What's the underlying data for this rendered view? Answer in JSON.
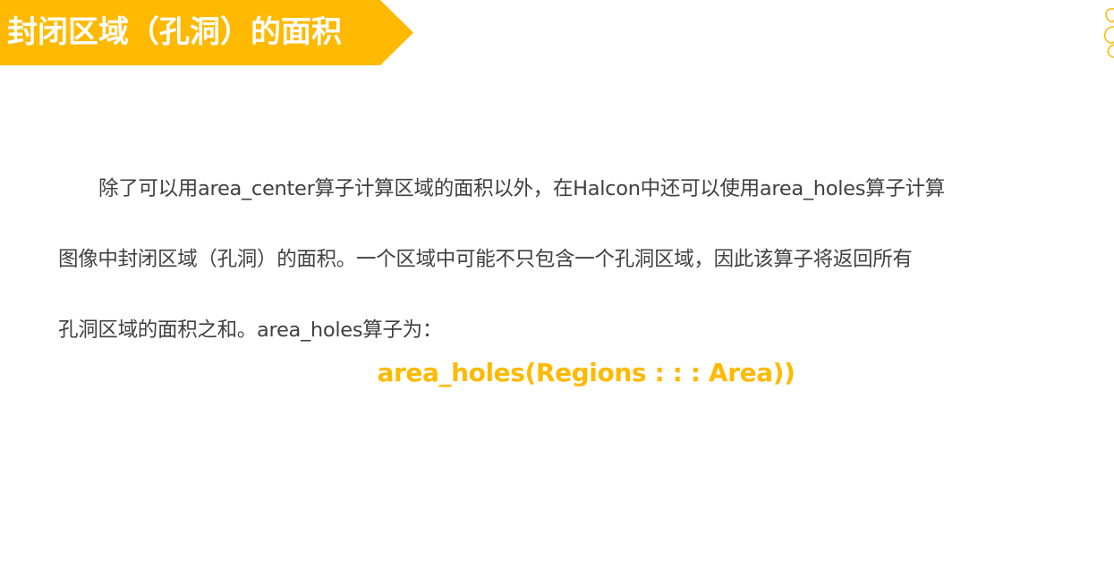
{
  "header": {
    "title": "封闭区域（孔洞）的面积",
    "accent_color": "#ffb900"
  },
  "body": {
    "paragraph_lines": [
      "除了可以用area_center算子计算区域的面积以外，在Halcon中还可以使用area_holes算子计算",
      "图像中封闭区域（孔洞）的面积。一个区域中可能不只包含一个孔洞区域，因此该算子将返回所有",
      "孔洞区域的面积之和。area_holes算子为："
    ],
    "formula": "area_holes(Regions : : : Area))"
  },
  "decoration": {
    "corner_icon": "curl-ornament-icon"
  }
}
